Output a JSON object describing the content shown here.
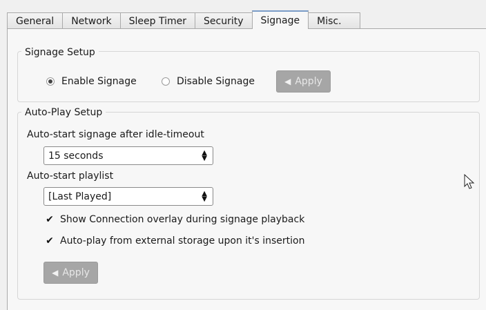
{
  "tabs": [
    {
      "label": "General",
      "active": false
    },
    {
      "label": "Network",
      "active": false
    },
    {
      "label": "Sleep Timer",
      "active": false
    },
    {
      "label": "Security",
      "active": false
    },
    {
      "label": "Signage",
      "active": true
    },
    {
      "label": "Misc.",
      "active": false
    }
  ],
  "signage_setup": {
    "title": "Signage Setup",
    "enable_label": "Enable Signage",
    "disable_label": "Disable Signage",
    "selected": "enable",
    "apply_label": "Apply",
    "apply_icon": "arrow-left-icon"
  },
  "autoplay_setup": {
    "title": "Auto-Play Setup",
    "idle_label": "Auto-start signage after idle-timeout",
    "idle_value": "15 seconds",
    "playlist_label": "Auto-start playlist",
    "playlist_value": "[Last Played]",
    "overlay_label": "Show Connection overlay during signage playback",
    "overlay_checked": true,
    "external_label": "Auto-play from external storage upon it's insertion",
    "external_checked": true,
    "apply_label": "Apply",
    "apply_icon": "arrow-left-icon"
  },
  "colors": {
    "panel_bg": "#f7f7f7",
    "disabled_button": "#a6a6a6",
    "active_tab_accent": "#7a9cc8"
  }
}
